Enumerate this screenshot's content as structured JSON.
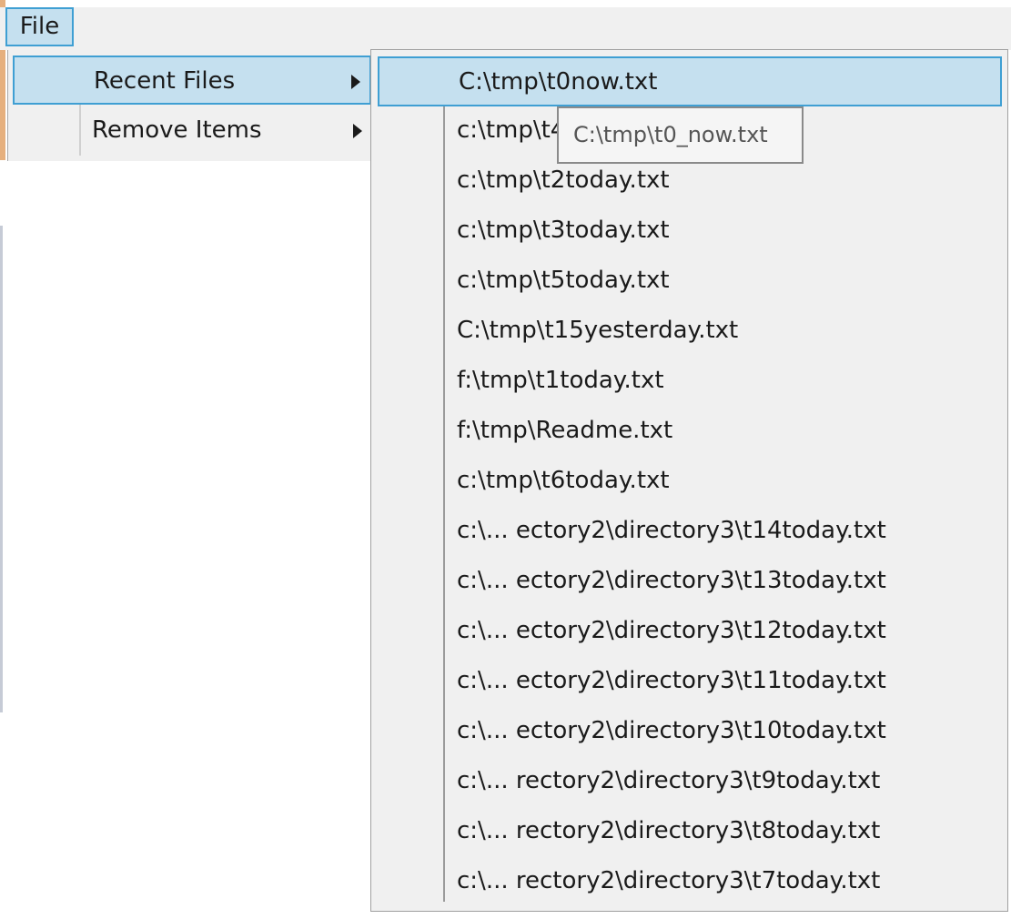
{
  "menubar": {
    "file_label": "File"
  },
  "file_menu": {
    "items": [
      {
        "label": "Recent Files"
      },
      {
        "label": "Remove Items"
      }
    ]
  },
  "recent_files": {
    "items": [
      "C:\\tmp\\t0now.txt",
      "c:\\tmp\\t4",
      "c:\\tmp\\t2today.txt",
      "c:\\tmp\\t3today.txt",
      "c:\\tmp\\t5today.txt",
      "C:\\tmp\\t15yesterday.txt",
      "f:\\tmp\\t1today.txt",
      "f:\\tmp\\Readme.txt",
      "c:\\tmp\\t6today.txt",
      "c:\\... ectory2\\directory3\\t14today.txt",
      "c:\\... ectory2\\directory3\\t13today.txt",
      "c:\\... ectory2\\directory3\\t12today.txt",
      "c:\\... ectory2\\directory3\\t11today.txt",
      "c:\\... ectory2\\directory3\\t10today.txt",
      "c:\\... rectory2\\directory3\\t9today.txt",
      "c:\\... rectory2\\directory3\\t8today.txt",
      "c:\\... rectory2\\directory3\\t7today.txt"
    ]
  },
  "tooltip": {
    "text": "C:\\tmp\\t0_now.txt"
  },
  "colors": {
    "highlight_bg": "#c5e0ef",
    "highlight_border": "#3f9fd3",
    "menu_bg": "#f0f0f0"
  }
}
